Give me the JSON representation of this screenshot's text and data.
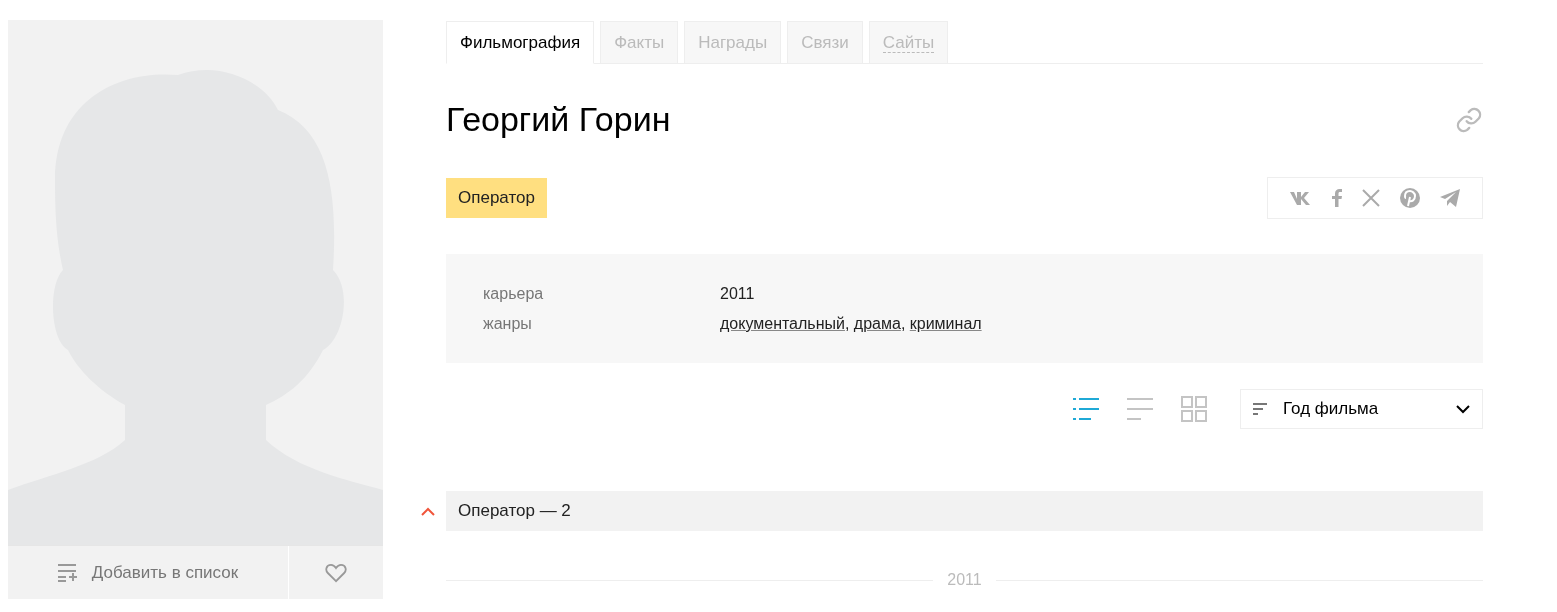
{
  "tabs": [
    {
      "label": "Фильмография",
      "selected": true
    },
    {
      "label": "Факты",
      "selected": false
    },
    {
      "label": "Награды",
      "selected": false
    },
    {
      "label": "Связи",
      "selected": false
    },
    {
      "label": "Сайты",
      "selected": false,
      "dotted": true
    }
  ],
  "name": "Георгий Горин",
  "profession": "Оператор",
  "info": [
    {
      "label": "карьера",
      "kind": "text",
      "value": "2011"
    },
    {
      "label": "жанры",
      "kind": "links",
      "links": [
        "документальный",
        "драма",
        "криминал"
      ],
      "separator": ","
    }
  ],
  "views": [
    {
      "kind": "list",
      "selected": true
    },
    {
      "kind": "lines",
      "selected": false
    },
    {
      "kind": "grid",
      "selected": false
    }
  ],
  "sort": {
    "value": "Год фильма"
  },
  "section": {
    "title": "Оператор — 2",
    "expanded": true
  },
  "year_divider": "2011",
  "add_to_list": "Добавить в список"
}
